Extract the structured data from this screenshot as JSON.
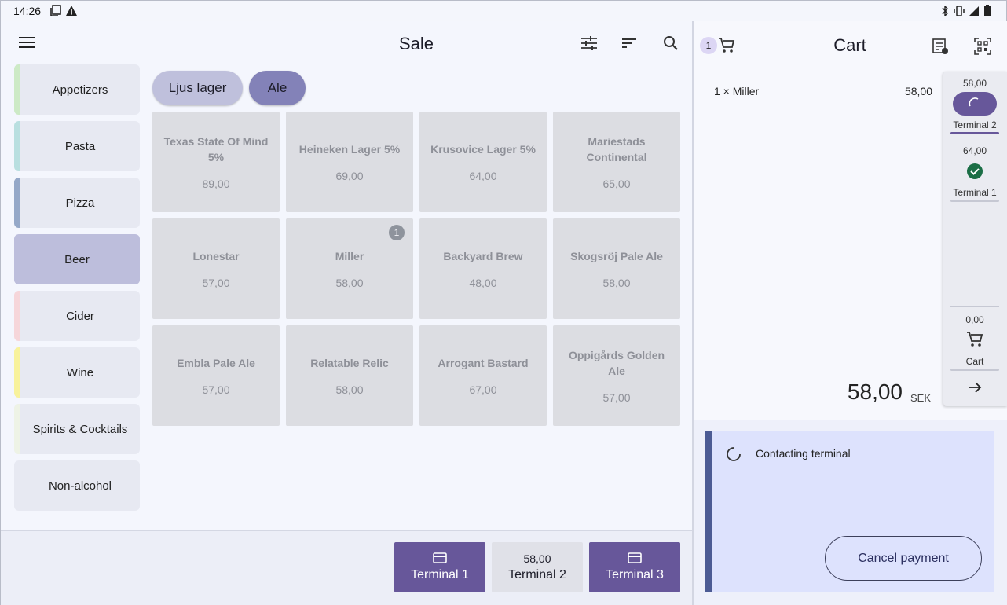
{
  "status_bar": {
    "time": "14:26"
  },
  "header": {
    "title": "Sale"
  },
  "categories": [
    {
      "label": "Appetizers",
      "color": "#cdeac6",
      "active": false
    },
    {
      "label": "Pasta",
      "color": "#b9dfe0",
      "active": false
    },
    {
      "label": "Pizza",
      "color": "#95a8c8",
      "active": false
    },
    {
      "label": "Beer",
      "color": "#bdbedc",
      "active": true
    },
    {
      "label": "Cider",
      "color": "#f6d6da",
      "active": false
    },
    {
      "label": "Wine",
      "color": "#f8f29c",
      "active": false
    },
    {
      "label": "Spirits & Cocktails",
      "color": "#eef3e6",
      "active": false
    },
    {
      "label": "Non-alcohol",
      "color": "#e7e9f2",
      "active": false
    }
  ],
  "subcategories": [
    {
      "label": "Ljus lager",
      "active": false
    },
    {
      "label": "Ale",
      "active": true
    }
  ],
  "products": [
    {
      "name": "Texas State Of Mind 5%",
      "price": "89,00",
      "badge": ""
    },
    {
      "name": "Heineken Lager 5%",
      "price": "69,00",
      "badge": ""
    },
    {
      "name": "Krusovice Lager 5%",
      "price": "64,00",
      "badge": ""
    },
    {
      "name": "Mariestads Continental",
      "price": "65,00",
      "badge": ""
    },
    {
      "name": "Lonestar",
      "price": "57,00",
      "badge": ""
    },
    {
      "name": "Miller",
      "price": "58,00",
      "badge": "1"
    },
    {
      "name": "Backyard Brew",
      "price": "48,00",
      "badge": ""
    },
    {
      "name": "Skogsröj Pale Ale",
      "price": "58,00",
      "badge": ""
    },
    {
      "name": "Embla Pale Ale",
      "price": "57,00",
      "badge": ""
    },
    {
      "name": "Relatable Relic",
      "price": "58,00",
      "badge": ""
    },
    {
      "name": "Arrogant Bastard",
      "price": "67,00",
      "badge": ""
    },
    {
      "name": "Oppigårds Golden Ale",
      "price": "57,00",
      "badge": ""
    }
  ],
  "terminal_buttons": [
    {
      "label": "Terminal 1",
      "amount": "",
      "style": "purple"
    },
    {
      "label": "Terminal 2",
      "amount": "58,00",
      "style": "grey"
    },
    {
      "label": "Terminal 3",
      "amount": "",
      "style": "purple"
    }
  ],
  "cart": {
    "title": "Cart",
    "count": "1",
    "line": {
      "qty_label": "1 × Miller",
      "price": "58,00"
    },
    "total": "58,00",
    "currency": "SEK"
  },
  "rail": {
    "terminal2": {
      "amount": "58,00",
      "label": "Terminal 2",
      "status": "processing"
    },
    "terminal1": {
      "amount": "64,00",
      "label": "Terminal 1",
      "status": "paid"
    },
    "cart": {
      "amount": "0,00",
      "label": "Cart"
    }
  },
  "payment": {
    "status": "Contacting terminal",
    "cancel_label": "Cancel payment"
  },
  "colors": {
    "accent": "#67579a",
    "rail_active": "#67579a",
    "success": "#1b6e46",
    "payment_strip": "#4c5b94"
  }
}
